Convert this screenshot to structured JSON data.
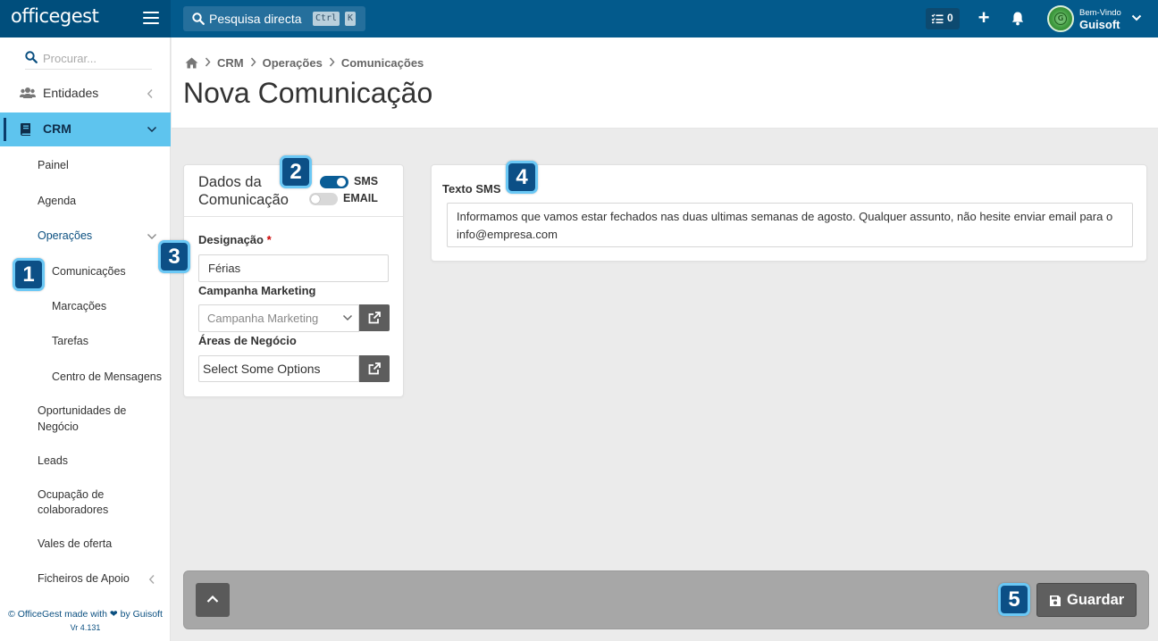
{
  "app": {
    "logo_text": "officegest",
    "brand_color": "#035a8c",
    "accent_color": "#5ec4ee"
  },
  "topbar": {
    "search_label": "Pesquisa directa",
    "shortcut_ctrl": "Ctrl",
    "shortcut_key": "K",
    "tasks_count": "0",
    "welcome": "Bem-Vindo",
    "user_name": "Guisoft",
    "avatar_glyph": "G"
  },
  "sidebar": {
    "search_placeholder": "Procurar...",
    "entidades": "Entidades",
    "crm": "CRM",
    "crm_items": {
      "painel": "Painel",
      "agenda": "Agenda",
      "operacoes": "Operações",
      "comunicacoes": "Comunicações",
      "marcacoes": "Marcações",
      "tarefas": "Tarefas",
      "centro_mensagens": "Centro de Mensagens",
      "oportunidades_1": "Oportunidades de",
      "oportunidades_2": "Negócio",
      "leads": "Leads",
      "ocupacao_1": "Ocupação de",
      "ocupacao_2": "colaboradores",
      "vales": "Vales de oferta",
      "ficheiros": "Ficheiros de Apoio"
    },
    "footer_left": "© OfficeGest made with",
    "footer_right": "by Guisoft",
    "version": "Vr 4.131"
  },
  "breadcrumb": {
    "crm": "CRM",
    "operacoes": "Operações",
    "comunicacoes": "Comunicações"
  },
  "page": {
    "title": "Nova Comunicação"
  },
  "form": {
    "card_title": "Dados da Comunicação",
    "sms_label": "SMS",
    "email_label": "EMAIL",
    "sms_enabled": true,
    "email_enabled": false,
    "designacao_label": "Designação",
    "required_mark": "*",
    "designacao_value": "Férias",
    "campanha_label": "Campanha Marketing",
    "campanha_placeholder": "Campanha Marketing",
    "areas_label": "Áreas de Negócio",
    "areas_placeholder": "Select Some Options"
  },
  "sms": {
    "label": "Texto SMS",
    "text": "Informamos que vamos estar fechados nas duas ultimas semanas de agosto. Qualquer assunto, não hesite enviar email para o info@empresa.com"
  },
  "footer_bar": {
    "save_label": "Guardar"
  },
  "badges": [
    "1",
    "2",
    "3",
    "4",
    "5"
  ]
}
